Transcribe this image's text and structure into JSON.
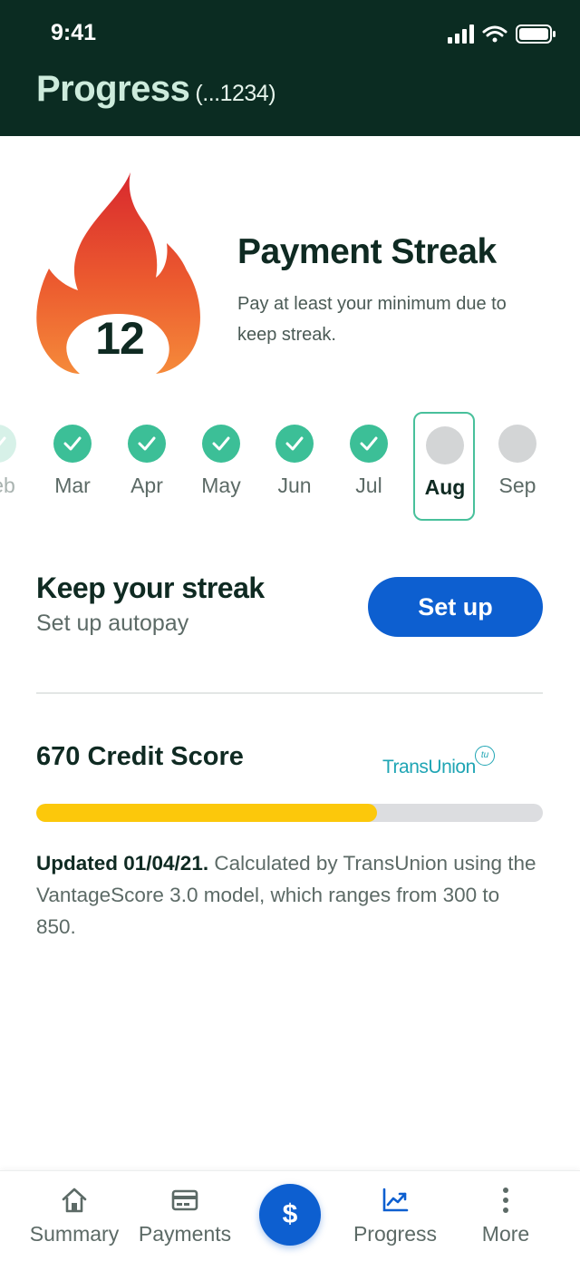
{
  "status_bar": {
    "time": "9:41"
  },
  "header": {
    "title": "Progress",
    "account": "(...1234)"
  },
  "streak": {
    "count": "12",
    "title": "Payment Streak",
    "description": "Pay at least your minimum due to keep streak."
  },
  "months": [
    {
      "label": "Feb",
      "status": "paid"
    },
    {
      "label": "Mar",
      "status": "paid"
    },
    {
      "label": "Apr",
      "status": "paid"
    },
    {
      "label": "May",
      "status": "paid"
    },
    {
      "label": "Jun",
      "status": "paid"
    },
    {
      "label": "Jul",
      "status": "paid"
    },
    {
      "label": "Aug",
      "status": "current"
    },
    {
      "label": "Sep",
      "status": "upcoming"
    }
  ],
  "autopay": {
    "title": "Keep your streak",
    "subtitle": "Set up autopay",
    "button_label": "Set up"
  },
  "credit": {
    "title": "670 Credit Score",
    "bureau_logo": "TransUnion",
    "bureau_badge": "tu",
    "score": 670,
    "score_min": 300,
    "score_max": 850,
    "updated": "Updated 01/04/21.",
    "description": " Calculated by TransUnion using the VantageScore 3.0 model, which ranges from 300 to 850."
  },
  "tabs": [
    {
      "label": "Summary",
      "icon": "home-icon"
    },
    {
      "label": "Payments",
      "icon": "card-icon"
    },
    {
      "label": "$",
      "icon": "dollar-icon"
    },
    {
      "label": "Progress",
      "icon": "chart-icon",
      "active": true
    },
    {
      "label": "More",
      "icon": "more-vertical-icon"
    }
  ],
  "colors": {
    "header_bg": "#0b2c22",
    "accent_green": "#3cbf97",
    "primary_blue": "#0d5fd0",
    "score_bar": "#fcc80b"
  }
}
